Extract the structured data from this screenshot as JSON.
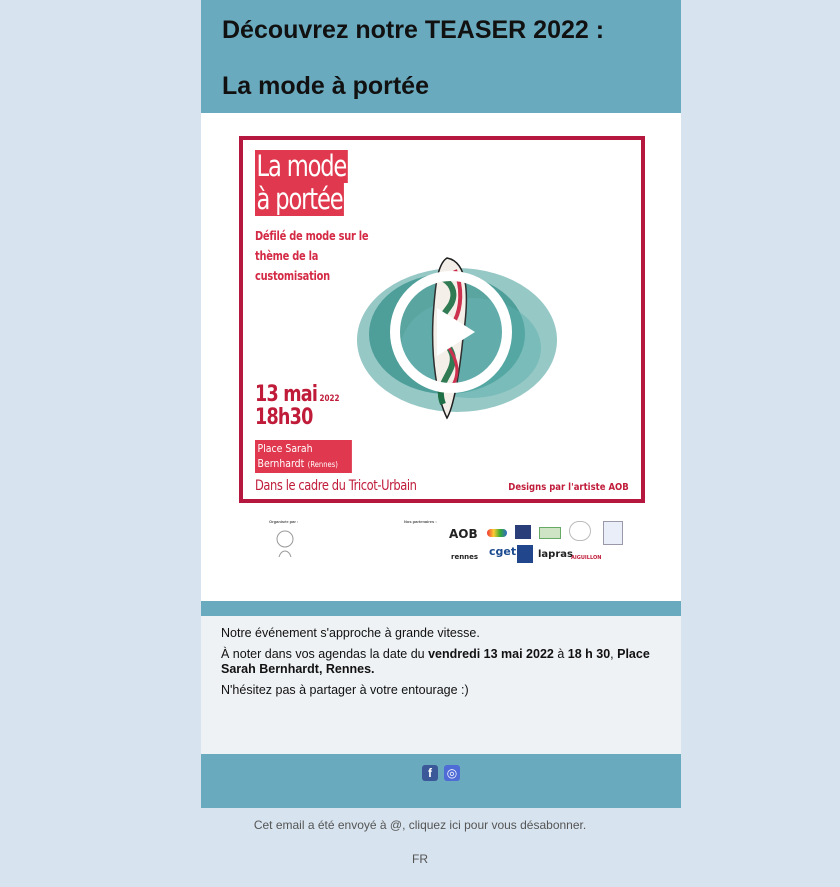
{
  "header": {
    "title_line1": "Découvrez notre TEASER 2022 :",
    "title_line2": "La mode à portée"
  },
  "poster": {
    "title_lines": [
      "La mode",
      "à portée"
    ],
    "subtitle": "Défilé de mode sur le thème de la customisation",
    "date": "13 mai",
    "year": "2022",
    "time": "18h30",
    "place": "Place Sarah Bernhardt",
    "place_city": "(Rennes)",
    "framework": "Dans le cadre du Tricot-Urbain",
    "designs": "Designs par l'artiste AOB",
    "organised_by_label": "Organisée par :",
    "partners_label": "Nos partenaires :",
    "partners": [
      "AOB",
      "rennes",
      "cget",
      "lapras",
      "AIGUILLON"
    ],
    "accent_color": "#e0384e",
    "frame_color": "#b5173f"
  },
  "video": {
    "play_icon": "play-icon"
  },
  "message": {
    "line1": "Notre événement s'approche à grande vitesse.",
    "line2_prefix": "À noter dans vos agendas la date du ",
    "line2_date": "vendredi 13 mai 2022",
    "line2_mid": " à ",
    "line2_time": "18 h 30",
    "line2_sep": ", ",
    "line2_place": "Place Sarah Bernhardt, Rennes.",
    "line3": "N'hésitez pas à partager à votre entourage :)"
  },
  "social": {
    "icons": [
      "facebook-icon",
      "instagram-icon"
    ],
    "facebook_glyph": "f",
    "instagram_glyph": "◎"
  },
  "footer": {
    "unsubscribe": "Cet email a été envoyé à @, cliquez ici pour vous désabonner.",
    "lang": "FR"
  },
  "colors": {
    "band": "#6aaabf",
    "page_bg": "#d7e3ee",
    "text_bg": "#eef2f5"
  }
}
